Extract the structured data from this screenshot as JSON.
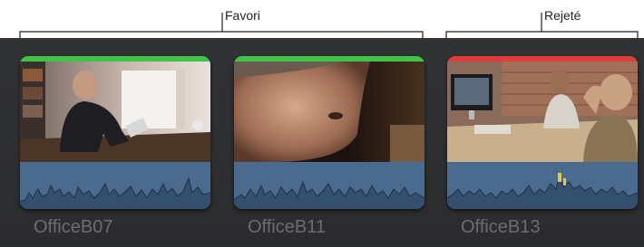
{
  "annotations": {
    "favorite_label": "Favori",
    "rejected_label": "Rejeté"
  },
  "clips": [
    {
      "name": "OfficeB07",
      "rating": "favorite",
      "rating_color": "#3fc44a"
    },
    {
      "name": "OfficeB11",
      "rating": "favorite",
      "rating_color": "#3fc44a"
    },
    {
      "name": "OfficeB13",
      "rating": "rejected",
      "rating_color": "#e23b3b"
    }
  ],
  "colors": {
    "panel_background": "#2e2f31",
    "audio_waveform_background": "#4a6a8e",
    "clip_name_text": "#6c6d70",
    "favorite": "#3fc44a",
    "rejected": "#e23b3b"
  }
}
